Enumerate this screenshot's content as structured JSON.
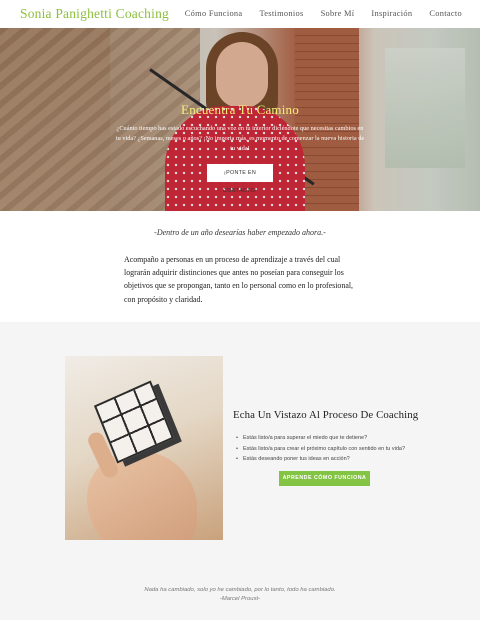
{
  "nav": {
    "brand": "Sonia Panighetti Coaching",
    "items": [
      {
        "label": "Cómo Funciona"
      },
      {
        "label": "Testimonios"
      },
      {
        "label": "Sobre Mí"
      },
      {
        "label": "Inspiración"
      },
      {
        "label": "Contacto"
      }
    ]
  },
  "hero": {
    "title": "Encuentra Tu Camino",
    "text": "¿Cuánto tiempo has estado escuchando una voz en tu interior diciéndote que necesitas cambios en tu vida? ¿Semanas, meses o años? ¡No importa más, es momento de comenzar la nueva historia de tu vida!",
    "button": "¡PONTE EN CONTACTO!"
  },
  "intro": {
    "quote": "-Dentro de un año desearías haber empezado ahora.-",
    "paragraph": "Acompaño a personas en un proceso de aprendizaje a través del cual lograrán adquirir distinciones que antes no poseían para conseguir los objetivos que se propongan, tanto en lo personal como en lo profesional, con propósito y claridad."
  },
  "process": {
    "title": "Echa Un Vistazo Al Proceso De Coaching",
    "bullets": [
      "Estás listo/a para superar el miedo que te detiene?",
      "Estás listo/a para crear el próximo capítulo con sentido en tu vida?",
      "Estás deseando poner tus ideas en acción?"
    ],
    "button": "APRENDE CÓMO FUNCIONA"
  },
  "footer_quote": {
    "text": "Nada ha cambiado, solo yo he cambiado, por lo tanto, todo ha cambiado.",
    "author": "-Marcel Proust-"
  },
  "colors": {
    "brand_green": "#8dbf3d",
    "button_green": "#84c444",
    "hero_title_yellow": "#f7f17a",
    "section_bg": "#f5f5f5"
  }
}
